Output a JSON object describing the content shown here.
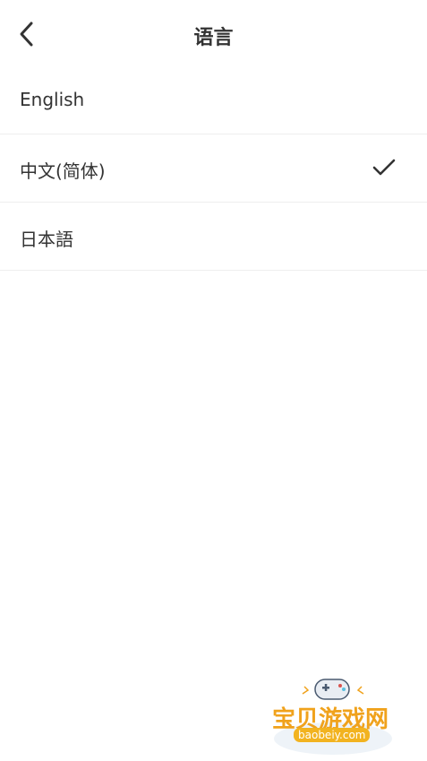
{
  "header": {
    "title": "语言",
    "back_icon": "chevron-left-icon"
  },
  "languages": [
    {
      "label": "English",
      "selected": false
    },
    {
      "label": "中文(简体)",
      "selected": true
    },
    {
      "label": "日本語",
      "selected": false
    }
  ],
  "selected_icon": "checkmark-icon",
  "watermark": {
    "brand": "宝贝游戏网",
    "url": "baobeiy.com",
    "accent_color": "#f0a21c"
  }
}
